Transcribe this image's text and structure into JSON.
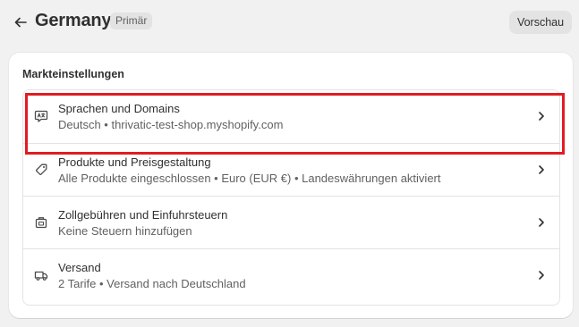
{
  "header": {
    "title": "Germany",
    "badge": "Primär",
    "preview_label": "Vorschau",
    "back_icon": "arrow-left-icon"
  },
  "card": {
    "title": "Markteinstellungen",
    "items": [
      {
        "icon": "language-icon",
        "title": "Sprachen und Domains",
        "subtitle": "Deutsch • thrivatic-test-shop.myshopify.com"
      },
      {
        "icon": "price-tag-icon",
        "title": "Produkte und Preisgestaltung",
        "subtitle": "Alle Produkte eingeschlossen • Euro (EUR €) • Landeswährungen aktiviert"
      },
      {
        "icon": "customs-icon",
        "title": "Zollgebühren und Einfuhrsteuern",
        "subtitle": "Keine Steuern hinzufügen"
      },
      {
        "icon": "truck-icon",
        "title": "Versand",
        "subtitle": "2 Tarife • Versand nach Deutschland"
      }
    ]
  },
  "colors": {
    "background": "#f1f1f1",
    "card": "#ffffff",
    "highlight": "#e11b22",
    "badge_bg": "#e3e3e3",
    "text_primary": "#303030",
    "text_secondary": "#616161"
  }
}
